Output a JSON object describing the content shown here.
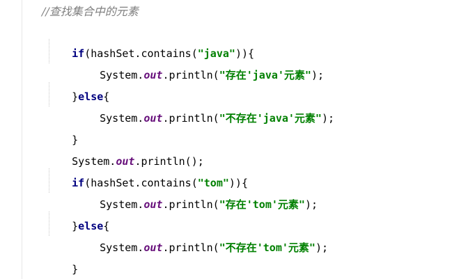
{
  "editor": {
    "comment": "//查找集合中的元素",
    "lines": [
      {
        "kw": "if",
        "a": "(hashSet.contains(",
        "str": "\"java\"",
        "b": ")){"
      },
      {
        "a": "System.",
        "fld": "out",
        "b": ".println(",
        "str": "\"存在'java'元素\"",
        "c": ");"
      },
      {
        "a": "}",
        "kw": "else",
        "b": "{"
      },
      {
        "a": "System.",
        "fld": "out",
        "b": ".println(",
        "str": "\"不存在'java'元素\"",
        "c": ");"
      },
      {
        "a": "}"
      },
      {
        "a": "System.",
        "fld": "out",
        "b": ".println();"
      },
      {
        "kw": "if",
        "a": "(hashSet.contains(",
        "str": "\"tom\"",
        "b": ")){"
      },
      {
        "a": "System.",
        "fld": "out",
        "b": ".println(",
        "str": "\"存在'tom'元素\"",
        "c": ");"
      },
      {
        "a": "}",
        "kw": "else",
        "b": "{"
      },
      {
        "a": "System.",
        "fld": "out",
        "b": ".println(",
        "str": "\"不存在'tom'元素\"",
        "c": ");"
      },
      {
        "a": "}"
      }
    ]
  }
}
